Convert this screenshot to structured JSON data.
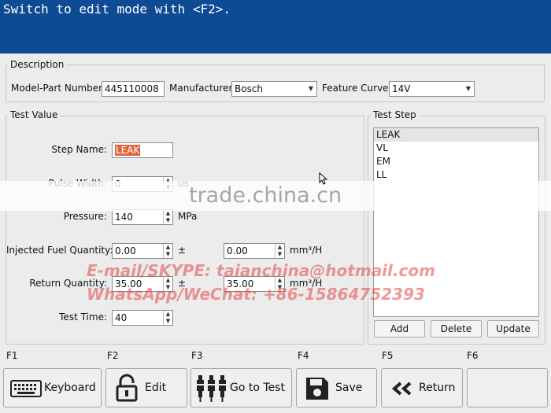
{
  "banner": {
    "text": "Switch to edit mode with <F2>."
  },
  "description": {
    "title": "Description",
    "model_label": "Model-Part Number:",
    "model_value": "445110008",
    "manufacturer_label": "Manufacturer:",
    "manufacturer_value": "Bosch",
    "curve_label": "Feature Curve:",
    "curve_value": "14V"
  },
  "test_value": {
    "title": "Test Value",
    "step_name_label": "Step Name:",
    "step_name_value": "LEAK",
    "pulse_width_label": "Pulse Width:",
    "pulse_width_value": "0",
    "pulse_width_unit": "us",
    "pressure_label": "Pressure:",
    "pressure_value": "140",
    "pressure_unit": "MPa",
    "injected_label": "Injected Fuel Quantity:",
    "injected_value": "0.00",
    "injected_tol": "0.00",
    "injected_unit": "mm³/H",
    "return_label": "Return Quantity:",
    "return_value": "35.00",
    "return_tol": "35.00",
    "return_unit": "mm³/H",
    "pm": "±",
    "test_time_label": "Test Time:",
    "test_time_value": "40"
  },
  "test_step": {
    "title": "Test Step",
    "items": [
      "LEAK",
      "VL",
      "EM",
      "LL"
    ],
    "add": "Add",
    "delete": "Delete",
    "update": "Update"
  },
  "function_keys": [
    "F1",
    "F2",
    "F3",
    "F4",
    "F5",
    "F6"
  ],
  "buttons": {
    "keyboard": "Keyboard",
    "edit": "Edit",
    "go_to_test": "Go to Test",
    "save": "Save",
    "return": "Return"
  },
  "watermark": {
    "site": "trade.china.cn",
    "email": "E-mail/SKYPE: taianchina@hotmail.com",
    "whatsapp": "WhatsApp/WeChat: +86-15864752393"
  }
}
